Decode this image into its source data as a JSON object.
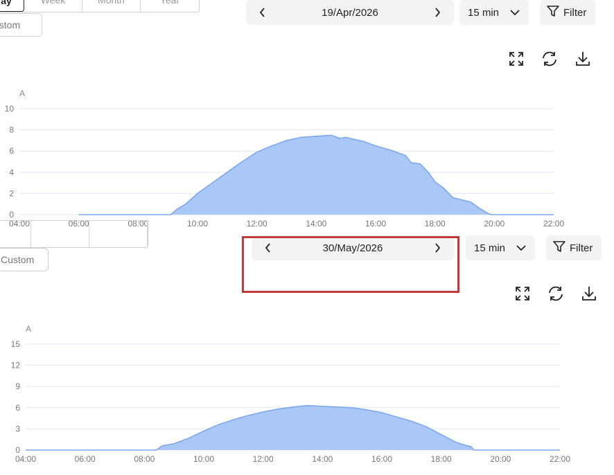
{
  "panels": [
    {
      "ranges": [
        "ay",
        "Week",
        "Month",
        "Year"
      ],
      "custom_label": "ustom",
      "date": "19/Apr/2026",
      "interval": "15 min",
      "filter_label": "Filter",
      "unit": "A"
    },
    {
      "ranges": [
        "",
        "",
        "",
        ""
      ],
      "custom_label": "Custom",
      "date": "30/May/2026",
      "interval": "15 min",
      "filter_label": "Filter",
      "unit": "A"
    }
  ],
  "colors": {
    "fill": "#a9c8f7",
    "stroke": "#7da7ec",
    "grid": "#e4e6ef",
    "highlight": "#c43a3a"
  },
  "icons": [
    "chevron-left-icon",
    "chevron-right-icon",
    "chevron-down-icon",
    "filter-icon",
    "expand-icon",
    "refresh-icon",
    "download-icon"
  ],
  "chart_data": [
    {
      "type": "area",
      "xlabel": "",
      "ylabel": "A",
      "x_ticks": [
        "04:00",
        "06:00",
        "08:00",
        "10:00",
        "12:00",
        "14:00",
        "16:00",
        "18:00",
        "20:00",
        "22:00"
      ],
      "y_ticks": [
        0,
        2,
        4,
        6,
        8,
        10
      ],
      "ylim": [
        0,
        10
      ],
      "xlim": [
        4,
        22
      ],
      "grid": true,
      "x": [
        6,
        9.1,
        9.3,
        9.6,
        10,
        10.5,
        11,
        11.5,
        12,
        12.5,
        13,
        13.5,
        14,
        14.5,
        14.8,
        15,
        15.3,
        15.6,
        16,
        16.5,
        17,
        17.2,
        17.5,
        17.8,
        18,
        18.3,
        18.6,
        18.9,
        19.2,
        19.5,
        19.8,
        19.9,
        22
      ],
      "y": [
        0,
        0,
        0.5,
        1,
        2,
        3,
        4,
        5,
        5.9,
        6.5,
        7,
        7.3,
        7.4,
        7.5,
        7.2,
        7.3,
        7.1,
        6.9,
        6.5,
        6.1,
        5.6,
        4.9,
        4.8,
        3.9,
        3.1,
        2.5,
        1.6,
        1.4,
        1.2,
        0.6,
        0.1,
        0,
        0
      ]
    },
    {
      "type": "area",
      "xlabel": "",
      "ylabel": "A",
      "x_ticks": [
        "04:00",
        "06:00",
        "08:00",
        "10:00",
        "12:00",
        "14:00",
        "16:00",
        "18:00",
        "20:00",
        "22:00"
      ],
      "y_ticks": [
        0,
        3,
        6,
        9,
        12,
        15
      ],
      "ylim": [
        0,
        15
      ],
      "xlim": [
        4,
        22
      ],
      "grid": true,
      "x": [
        4,
        8.4,
        8.6,
        9,
        9.5,
        10,
        10.5,
        11,
        11.5,
        12,
        12.5,
        13,
        13.5,
        14,
        14.5,
        15,
        15.5,
        16,
        16.5,
        17,
        17.5,
        18,
        18.5,
        18.8,
        19,
        19.1,
        22
      ],
      "y": [
        0,
        0,
        0.6,
        0.9,
        1.7,
        2.7,
        3.6,
        4.3,
        4.9,
        5.4,
        5.8,
        6.1,
        6.3,
        6.2,
        6.1,
        6,
        5.7,
        5.3,
        4.7,
        4.1,
        3.3,
        2.2,
        1.1,
        0.7,
        0.5,
        0,
        0
      ]
    }
  ]
}
